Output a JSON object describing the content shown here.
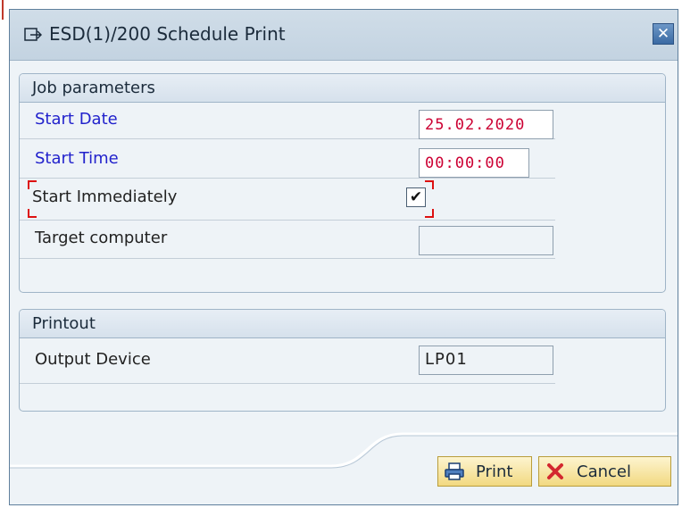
{
  "dialog": {
    "title": "ESD(1)/200 Schedule Print",
    "close_glyph": "✕"
  },
  "job_parameters": {
    "header": "Job parameters",
    "start_date": {
      "label": "Start Date",
      "value": "25.02.2020"
    },
    "start_time": {
      "label": "Start Time",
      "value": "00:00:00"
    },
    "start_immediately": {
      "label": "Start Immediately",
      "checked": true
    },
    "target_computer": {
      "label": "Target computer",
      "value": ""
    }
  },
  "printout": {
    "header": "Printout",
    "output_device": {
      "label": "Output Device",
      "value": "LP01"
    }
  },
  "buttons": {
    "print": "Print",
    "cancel": "Cancel"
  },
  "colors": {
    "required_label": "#2222cc",
    "invalid_value": "#cc0033",
    "button_bg": "#f2d981"
  },
  "icons": {
    "title": "export-icon",
    "close": "close-icon",
    "print": "printer-icon",
    "cancel": "cancel-x-icon"
  }
}
